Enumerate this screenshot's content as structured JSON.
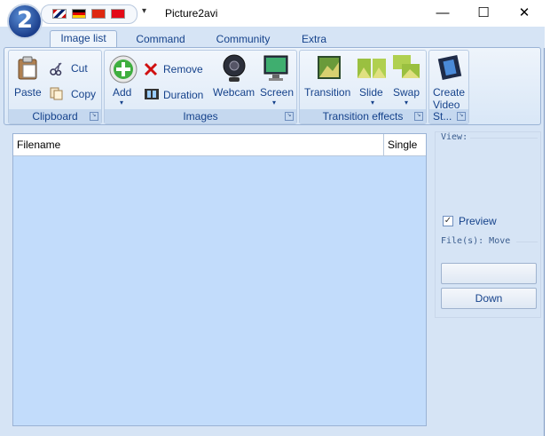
{
  "window": {
    "title": "Picture2avi",
    "logo_text": "2",
    "qat_dropdown": "▾",
    "controls": {
      "minimize": "—",
      "maximize": "☐",
      "close": "✕"
    }
  },
  "tabs": [
    {
      "label": "Image list",
      "active": true
    },
    {
      "label": "Command",
      "active": false
    },
    {
      "label": "Community",
      "active": false
    },
    {
      "label": "Extra",
      "active": false
    }
  ],
  "ribbon": {
    "clipboard": {
      "label": "Clipboard",
      "paste": "Paste",
      "cut": "Cut",
      "copy": "Copy"
    },
    "images": {
      "label": "Images",
      "add": "Add",
      "remove": "Remove",
      "duration": "Duration",
      "webcam": "Webcam",
      "screen": "Screen"
    },
    "transition": {
      "label": "Transition effects",
      "transition": "Transition",
      "slide": "Slide",
      "swap": "Swap"
    },
    "start": {
      "label": "St...",
      "create_video": "Create\nVideo"
    }
  },
  "list": {
    "columns": [
      "Filename",
      "Single"
    ]
  },
  "side": {
    "view_label": "View:",
    "preview_label": "Preview",
    "preview_checked": "✓",
    "files_move_label": "File(s): Move",
    "up_button": "",
    "down_button": "Down"
  },
  "colors": {
    "accent": "#15428b",
    "list_bg": "#c2dcfb",
    "ribbon_bg": "#d6e4f5"
  }
}
